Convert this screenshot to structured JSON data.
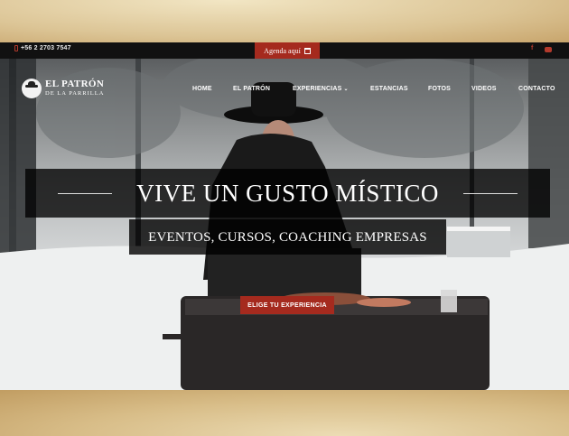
{
  "topbar": {
    "phone": "+56 2 2703 7547",
    "agenda_label": "Agenda aquí"
  },
  "brand": {
    "line1": "EL PATRÓN",
    "line2": "DE LA PARRILLA"
  },
  "nav": {
    "items": [
      {
        "label": "HOME"
      },
      {
        "label": "EL PATRÓN"
      },
      {
        "label": "EXPERIENCIAS"
      },
      {
        "label": "ESTANCIAS"
      },
      {
        "label": "FOTOS"
      },
      {
        "label": "VIDEOS"
      },
      {
        "label": "CONTACTO"
      }
    ]
  },
  "hero": {
    "headline": "VIVE UN GUSTO MÍSTICO",
    "subheadline": "EVENTOS, CURSOS, COACHING EMPRESAS",
    "cta_label": "ELIGE TU EXPERIENCIA"
  },
  "icons": {
    "phone": "phone-icon",
    "calendar": "calendar-icon",
    "facebook": "facebook-icon",
    "youtube": "youtube-icon",
    "dropdown": "chevron-down-icon"
  },
  "colors": {
    "accent": "#a52a1e",
    "topbar": "#111111"
  }
}
